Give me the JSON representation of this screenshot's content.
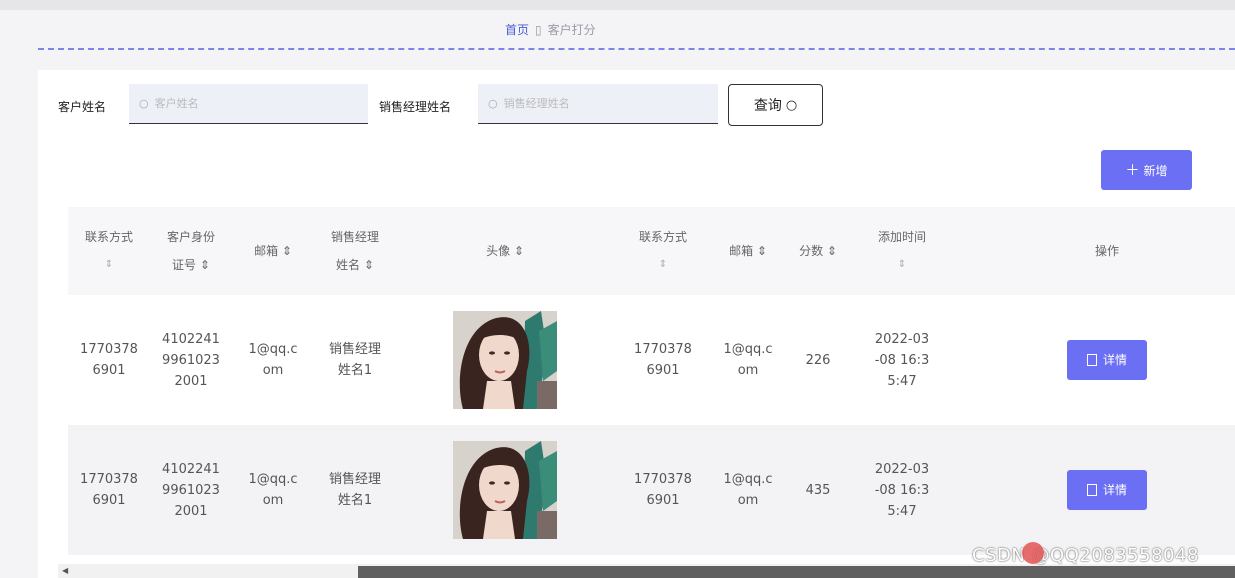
{
  "breadcrumb": {
    "home": "首页",
    "current": "客户打分"
  },
  "search": {
    "customer_label": "客户姓名",
    "customer_placeholder": "客户姓名",
    "manager_label": "销售经理姓名",
    "manager_placeholder": "销售经理姓名",
    "query_label": "查询"
  },
  "toolbar": {
    "add_label": "新增"
  },
  "table": {
    "headers": [
      "联系方式",
      "客户身份证号",
      "邮箱",
      "销售经理姓名",
      "头像",
      "联系方式",
      "邮箱",
      "分数",
      "添加时间",
      "操作"
    ],
    "header_lines": {
      "contact1": [
        "联系方式",
        "⇕"
      ],
      "id": [
        "客户身份",
        "证号 ⇕"
      ],
      "email1": "邮箱 ⇕",
      "manager": [
        "销售经理",
        "姓名 ⇕"
      ],
      "avatar": "头像 ⇕",
      "contact2": [
        "联系方式",
        "⇕"
      ],
      "email2": "邮箱 ⇕",
      "score": "分数 ⇕",
      "time": [
        "添加时间",
        "⇕"
      ],
      "action": "操作"
    },
    "rows": [
      {
        "contact1": [
          "1770378",
          "6901"
        ],
        "id": [
          "4102241",
          "9961023",
          "2001"
        ],
        "email1": [
          "1@qq.c",
          "om"
        ],
        "manager": [
          "销售经理",
          "姓名1"
        ],
        "contact2": [
          "1770378",
          "6901"
        ],
        "email2": [
          "1@qq.c",
          "om"
        ],
        "score": "226",
        "time": [
          "2022-03",
          "-08 16:3",
          "5:47"
        ],
        "action": "详情"
      },
      {
        "contact1": [
          "1770378",
          "6901"
        ],
        "id": [
          "4102241",
          "9961023",
          "2001"
        ],
        "email1": [
          "1@qq.c",
          "om"
        ],
        "manager": [
          "销售经理",
          "姓名1"
        ],
        "contact2": [
          "1770378",
          "6901"
        ],
        "email2": [
          "1@qq.c",
          "om"
        ],
        "score": "435",
        "time": [
          "2022-03",
          "-08 16:3",
          "5:47"
        ],
        "action": "详情"
      }
    ]
  },
  "watermark": "CSDN @QQ2083558048",
  "colors": {
    "accent": "#6a6ff4",
    "breadcrumb_active": "#4a5bd6",
    "dash": "#7b86e8"
  },
  "icons": {
    "search": "search-icon",
    "plus": "plus-icon",
    "detail": "document-icon",
    "sort": "sort-icon"
  }
}
